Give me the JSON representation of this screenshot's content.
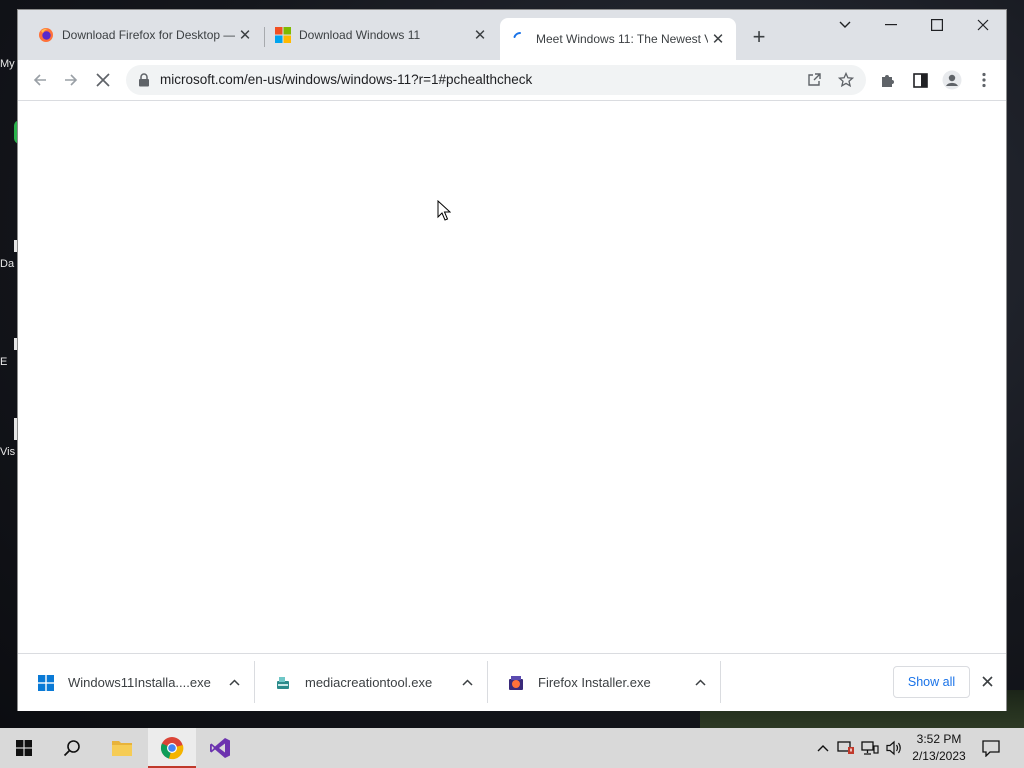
{
  "desktop": {
    "icons": [
      {
        "label": "My"
      },
      {
        "label": ""
      },
      {
        "label": "Da"
      },
      {
        "label": "E"
      },
      {
        "label": "Vis"
      }
    ]
  },
  "browser": {
    "tabs": [
      {
        "title": "Download Firefox for Desktop — ",
        "favicon": "firefox-icon",
        "active": false
      },
      {
        "title": "Download Windows 11",
        "favicon": "windows-logo-icon",
        "active": false
      },
      {
        "title": "Meet Windows 11: The Newest V",
        "favicon": "loading-spinner-icon",
        "active": true
      }
    ],
    "new_tab": "+",
    "url": "microsoft.com/en-us/windows/windows-11?r=1#pchealthcheck",
    "accent": "#1a73e8"
  },
  "downloads": {
    "items": [
      {
        "name": "Windows11Installa....exe",
        "icon": "windows-logo-icon"
      },
      {
        "name": "mediacreationtool.exe",
        "icon": "media-creation-tool-icon"
      },
      {
        "name": "Firefox Installer.exe",
        "icon": "firefox-installer-icon"
      }
    ],
    "show_all": "Show all"
  },
  "taskbar": {
    "clock": {
      "time": "3:52 PM",
      "date": "2/13/2023"
    }
  }
}
